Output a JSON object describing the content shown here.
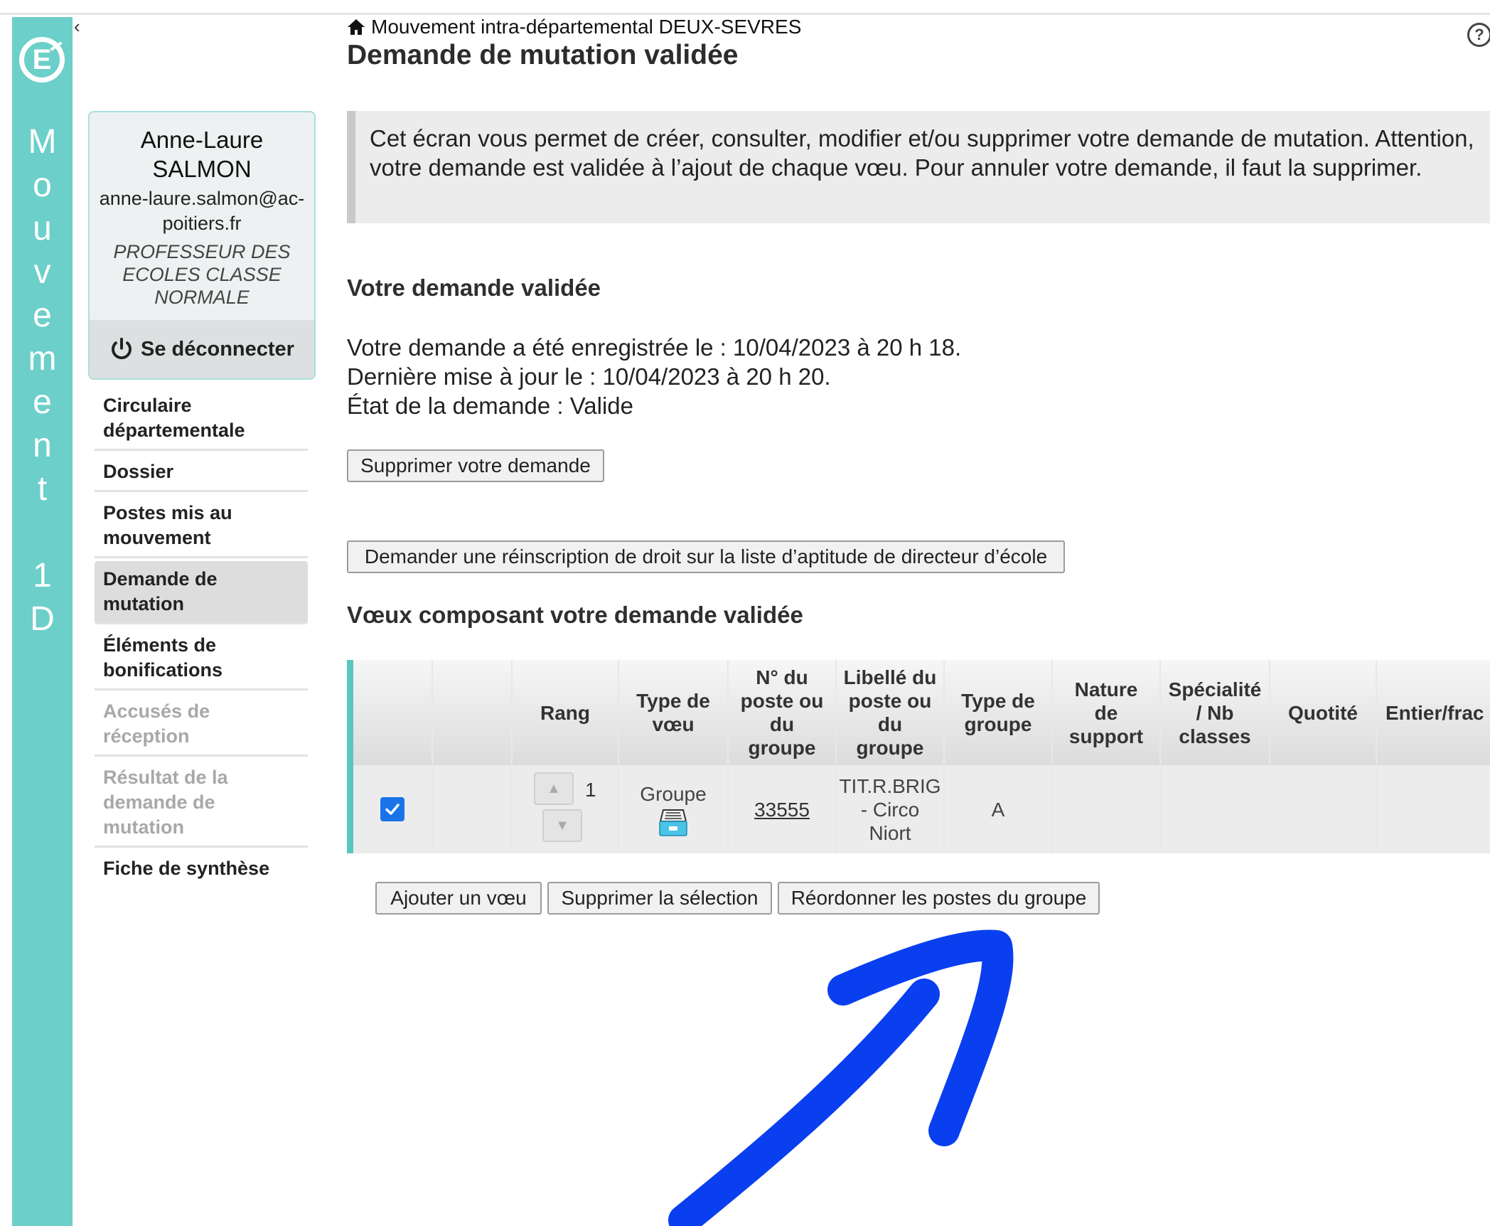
{
  "app": {
    "sidebar_vertical_text": [
      "M",
      "o",
      "u",
      "v",
      "e",
      "m",
      "e",
      "n",
      "t",
      "",
      "1",
      "D"
    ],
    "logo_letter": "E"
  },
  "header": {
    "breadcrumb": "Mouvement intra-départemental DEUX-SEVRES",
    "title": "Demande de mutation validée",
    "help_label": "?"
  },
  "user": {
    "name": "Anne-Laure SALMON",
    "email": "anne-laure.salmon@ac-poitiers.fr",
    "role": "PROFESSEUR DES ECOLES CLASSE NORMALE",
    "logout_label": "Se déconnecter"
  },
  "nav": {
    "items": [
      {
        "label": "Circulaire départementale",
        "state": "normal"
      },
      {
        "label": "Dossier",
        "state": "normal"
      },
      {
        "label": "Postes mis au mouvement",
        "state": "normal"
      },
      {
        "label": "Demande de mutation",
        "state": "active"
      },
      {
        "label": "Éléments de bonifications",
        "state": "normal"
      },
      {
        "label": "Accusés de réception",
        "state": "disabled"
      },
      {
        "label": "Résultat de la demande de mutation",
        "state": "disabled"
      },
      {
        "label": "Fiche de synthèse",
        "state": "normal"
      }
    ]
  },
  "info_text": "Cet écran vous permet de créer, consulter, modifier et/ou supprimer votre demande de mutation. Attention, votre demande est validée à l’ajout de chaque vœu. Pour annuler votre demande, il faut la supprimer.",
  "demande": {
    "heading": "Votre demande validée",
    "registered": "Votre demande a été enregistrée le : 10/04/2023 à 20 h 18.",
    "updated": "Dernière mise à jour le : 10/04/2023 à 20 h 20.",
    "state": "État de la demande : Valide",
    "delete_button": "Supprimer votre demande",
    "reinscription_button": "Demander une réinscription de droit sur la liste d’aptitude de directeur d’école"
  },
  "voeux": {
    "heading": "Vœux composant votre demande validée",
    "columns": [
      "",
      "",
      "Rang",
      "Type de vœu",
      "N° du poste ou du groupe",
      "Libellé du poste ou du groupe",
      "Type de groupe",
      "Nature de support",
      "Spécialité / Nb classes",
      "Quotité",
      "Entier/frac"
    ],
    "rows": [
      {
        "checked": true,
        "rang": "1",
        "type_voeu": "Groupe",
        "numero": "33555",
        "libelle": "TIT.R.BRIG - Circo Niort",
        "type_groupe": "A",
        "nature_support": "",
        "specialite": "",
        "quotite": "",
        "entier_frac": ""
      }
    ],
    "buttons": {
      "add": "Ajouter un vœu",
      "delete_selection": "Supprimer la sélection",
      "reorder": "Réordonner les postes du groupe"
    }
  },
  "colors": {
    "teal": "#6ccfc9",
    "annotation_arrow": "#0a3ff0",
    "checkbox": "#1a73e8"
  }
}
